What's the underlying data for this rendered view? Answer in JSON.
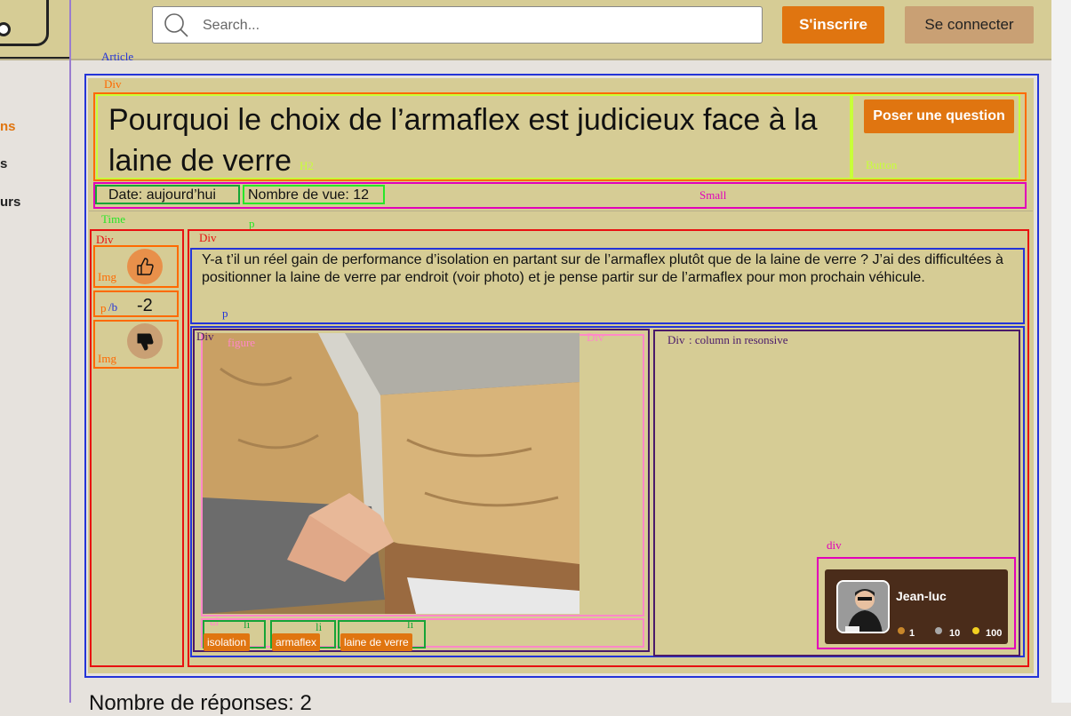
{
  "header": {
    "logo_text": "!?",
    "search_placeholder": "Search...",
    "signup_label": "S'inscrire",
    "login_label": "Se connecter"
  },
  "nav": {
    "items": [
      "ns",
      "s",
      "urs"
    ]
  },
  "annotations": {
    "article": "Article",
    "div_title": "Div",
    "h2": "H2",
    "button": "Button",
    "small": "Small",
    "time": "Time",
    "p_top": "p",
    "div_vote": "Div",
    "img_up": "Img",
    "p": "p",
    "b": "/b",
    "img_down": "Img",
    "div_main": "Div",
    "p_question": "p",
    "div_left": "Div",
    "figure": "figure",
    "div_figure": "Div",
    "div_right": "Div",
    "div_right_note": ": column  in  resonsive",
    "div_user": "div",
    "ul": "ul",
    "li_1": "li",
    "li_2": "li",
    "li_3": "li"
  },
  "question": {
    "title": "Pourquoi le choix de l’armaflex est judicieux face à la laine de verre",
    "ask_button": "Poser une question",
    "date": "Date: aujourd’hui",
    "views": "Nombre de vue: 12",
    "score": "-2",
    "body": "Y-a t’il un réel gain de performance d’isolation en partant sur de l’armaflex plutôt que de la laine de verre ? J’ai des difficultées à positionner la laine de verre par endroit (voir photo) et je pense partir sur de l’armaflex pour mon prochain véhicule.",
    "tags": [
      "isolation",
      "armaflex",
      "laine de verre"
    ]
  },
  "user": {
    "name": "Jean-luc",
    "bronze": "1",
    "silver": "10",
    "gold": "100",
    "colors": {
      "bronze": "#c8862a",
      "silver": "#a8a8a8",
      "gold": "#f2d020"
    }
  },
  "answers_heading": "Nombre de réponses: 2",
  "colors": {
    "accent": "#e07510",
    "header_bg": "#d6cc95",
    "card_bg": "#4a2c1a"
  }
}
